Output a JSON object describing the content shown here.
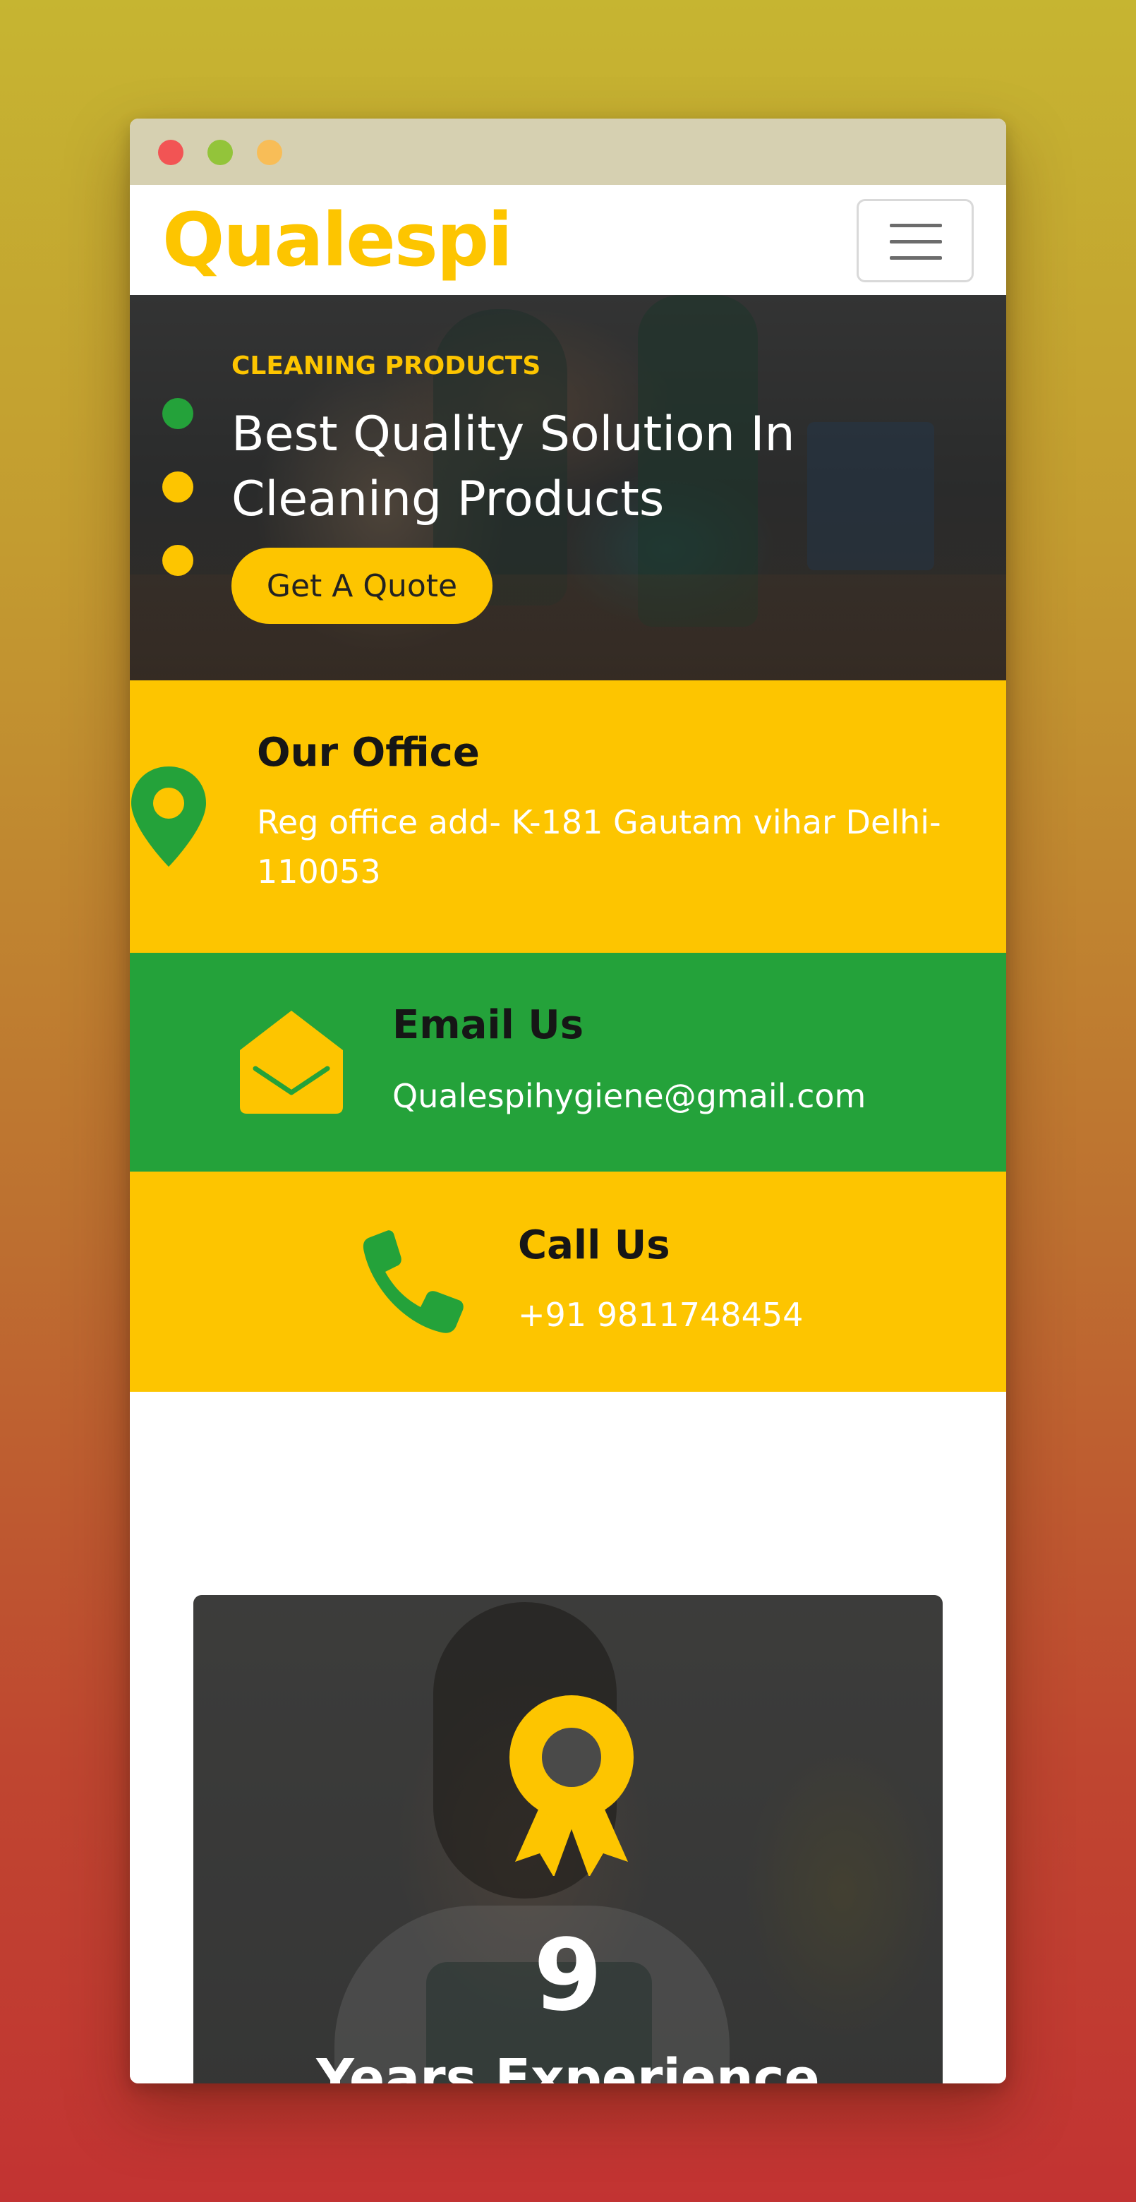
{
  "colors": {
    "brand_yellow": "#fdc500",
    "brand_green": "#24a23a",
    "dark_text": "#161616",
    "white": "#ffffff"
  },
  "window": {
    "controls": [
      "close",
      "minimize",
      "maximize"
    ]
  },
  "navbar": {
    "brand": "Qualespi",
    "menu_icon": "hamburger-icon"
  },
  "hero": {
    "kicker": "CLEANING PRODUCTS",
    "title": "Best Quality Solution In Cleaning Products",
    "cta_label": "Get A Quote",
    "carousel": {
      "slides": 3,
      "active_index": 0
    }
  },
  "contact": {
    "office": {
      "icon": "map-pin-icon",
      "title": "Our Office",
      "text": "Reg office add- K-181 Gautam vihar Delhi-110053"
    },
    "email": {
      "icon": "envelope-open-icon",
      "title": "Email Us",
      "text": "Qualespihygiene@gmail.com"
    },
    "call": {
      "icon": "phone-icon",
      "title": "Call Us",
      "text": "+91 9811748454"
    }
  },
  "experience": {
    "icon": "award-icon",
    "number": "9",
    "label": "Years Experience"
  }
}
